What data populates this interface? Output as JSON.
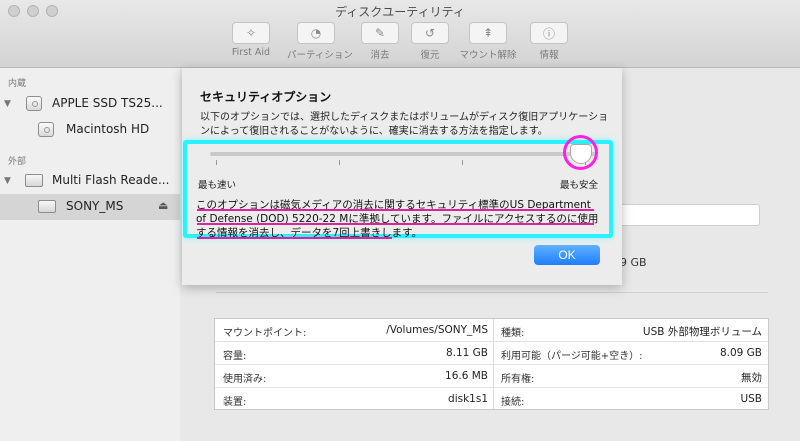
{
  "window": {
    "title": "ディスクユーティリティ"
  },
  "toolbar": [
    {
      "label": "First Aid",
      "icon": "first-aid-icon",
      "glyph": "✧"
    },
    {
      "label": "パーティション",
      "icon": "partition-icon",
      "glyph": "◔"
    },
    {
      "label": "消去",
      "icon": "erase-icon",
      "glyph": "✎"
    },
    {
      "label": "復元",
      "icon": "restore-icon",
      "glyph": "↺"
    },
    {
      "label": "マウント解除",
      "icon": "unmount-icon",
      "glyph": "⇞"
    },
    {
      "label": "情報",
      "icon": "info-icon",
      "glyph": "ⓘ"
    }
  ],
  "sidebar": {
    "internal_header": "内蔵",
    "external_header": "外部",
    "items": [
      {
        "label": "APPLE SSD TS25..."
      },
      {
        "label": "Macintosh HD"
      },
      {
        "label": "Multi Flash Reade..."
      },
      {
        "label": "SONY_MS",
        "eject": "⏏"
      }
    ]
  },
  "main": {
    "size_fragment": "9 GB"
  },
  "info": {
    "rows": [
      {
        "lk": "マウントポイント:",
        "lv": "/Volumes/SONY_MS",
        "rk": "種類:",
        "rv": "USB 外部物理ボリューム"
      },
      {
        "lk": "容量:",
        "lv": "8.11 GB",
        "rk": "利用可能（パージ可能+空き）:",
        "rv": "8.09 GB"
      },
      {
        "lk": "使用済み:",
        "lv": "16.6 MB",
        "rk": "所有権:",
        "rv": "無効"
      },
      {
        "lk": "装置:",
        "lv": "disk1s1",
        "rk": "接続:",
        "rv": "USB"
      }
    ]
  },
  "sheet": {
    "title": "セキュリティオプション",
    "description": "以下のオプションでは、選択したディスクまたはボリュームがディスク復旧アプリケーションによって復旧されることがないように、確実に消去する方法を指定します。",
    "slider": {
      "min_label": "最も速い",
      "max_label": "最も安全",
      "value_fraction": 1.0,
      "steps": 4
    },
    "security_text": "このオプションは磁気メディアの消去に関するセキュリティ標準のUS Department of Defense (DOD) 5220-22 Mに準拠しています。ファイルにアクセスするのに使用する情報を消去し、データを7回上書きします。",
    "ok_label": "OK"
  },
  "colors": {
    "highlight_cyan": "#2cf0ff",
    "annotation_magenta": "#ff20e0",
    "ok_blue": "#1f7dff"
  }
}
